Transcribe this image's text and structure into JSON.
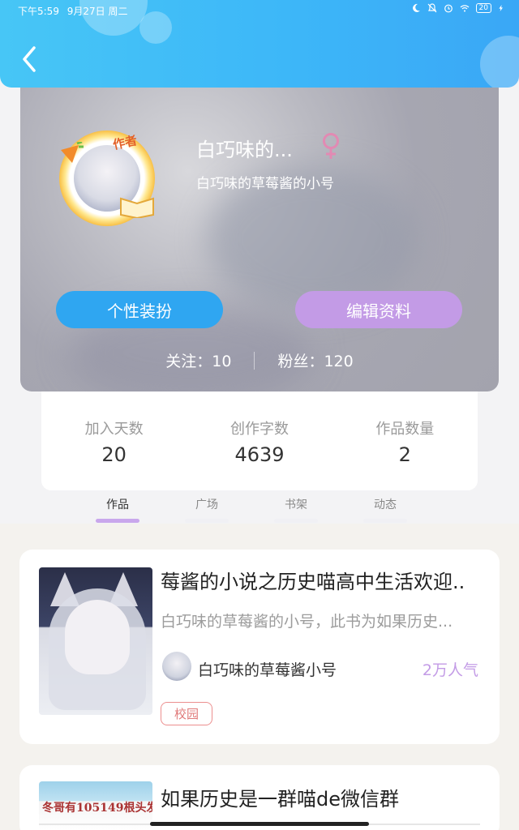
{
  "status_bar": {
    "time": "下午5:59",
    "date": "9月27日 周二",
    "battery": "20"
  },
  "header": {
    "back_icon": "chevron-left-icon"
  },
  "profile": {
    "badge": "作者",
    "name": "白巧味的...",
    "gender_icon": "female-icon",
    "bio": "白巧味的草莓酱的小号",
    "buttons": {
      "dress_up": "个性装扮",
      "edit_profile": "编辑资料"
    },
    "following_label": "关注：10",
    "fans_label": "粉丝：120"
  },
  "stats": [
    {
      "label": "加入天数",
      "value": "20"
    },
    {
      "label": "创作字数",
      "value": "4639"
    },
    {
      "label": "作品数量",
      "value": "2"
    }
  ],
  "tabs": [
    {
      "label": "作品",
      "active": true
    },
    {
      "label": "广场",
      "active": false
    },
    {
      "label": "书架",
      "active": false
    },
    {
      "label": "动态",
      "active": false
    }
  ],
  "books": [
    {
      "title": "莓酱的小说之历史喵高中生活欢迎..",
      "description": "白巧味的草莓酱的小号，此书为如果历史...",
      "author": "白巧味的草莓酱小号",
      "popularity": "2万人气",
      "tag": "校园"
    },
    {
      "title": "如果历史是一群喵de微信群",
      "cover_text": "冬哥有105149根头发"
    }
  ],
  "colors": {
    "header_blue": "#3db7f8",
    "dress_button": "#2fa6f1",
    "edit_button": "#c39be6",
    "tag_red": "#e07a7a"
  }
}
